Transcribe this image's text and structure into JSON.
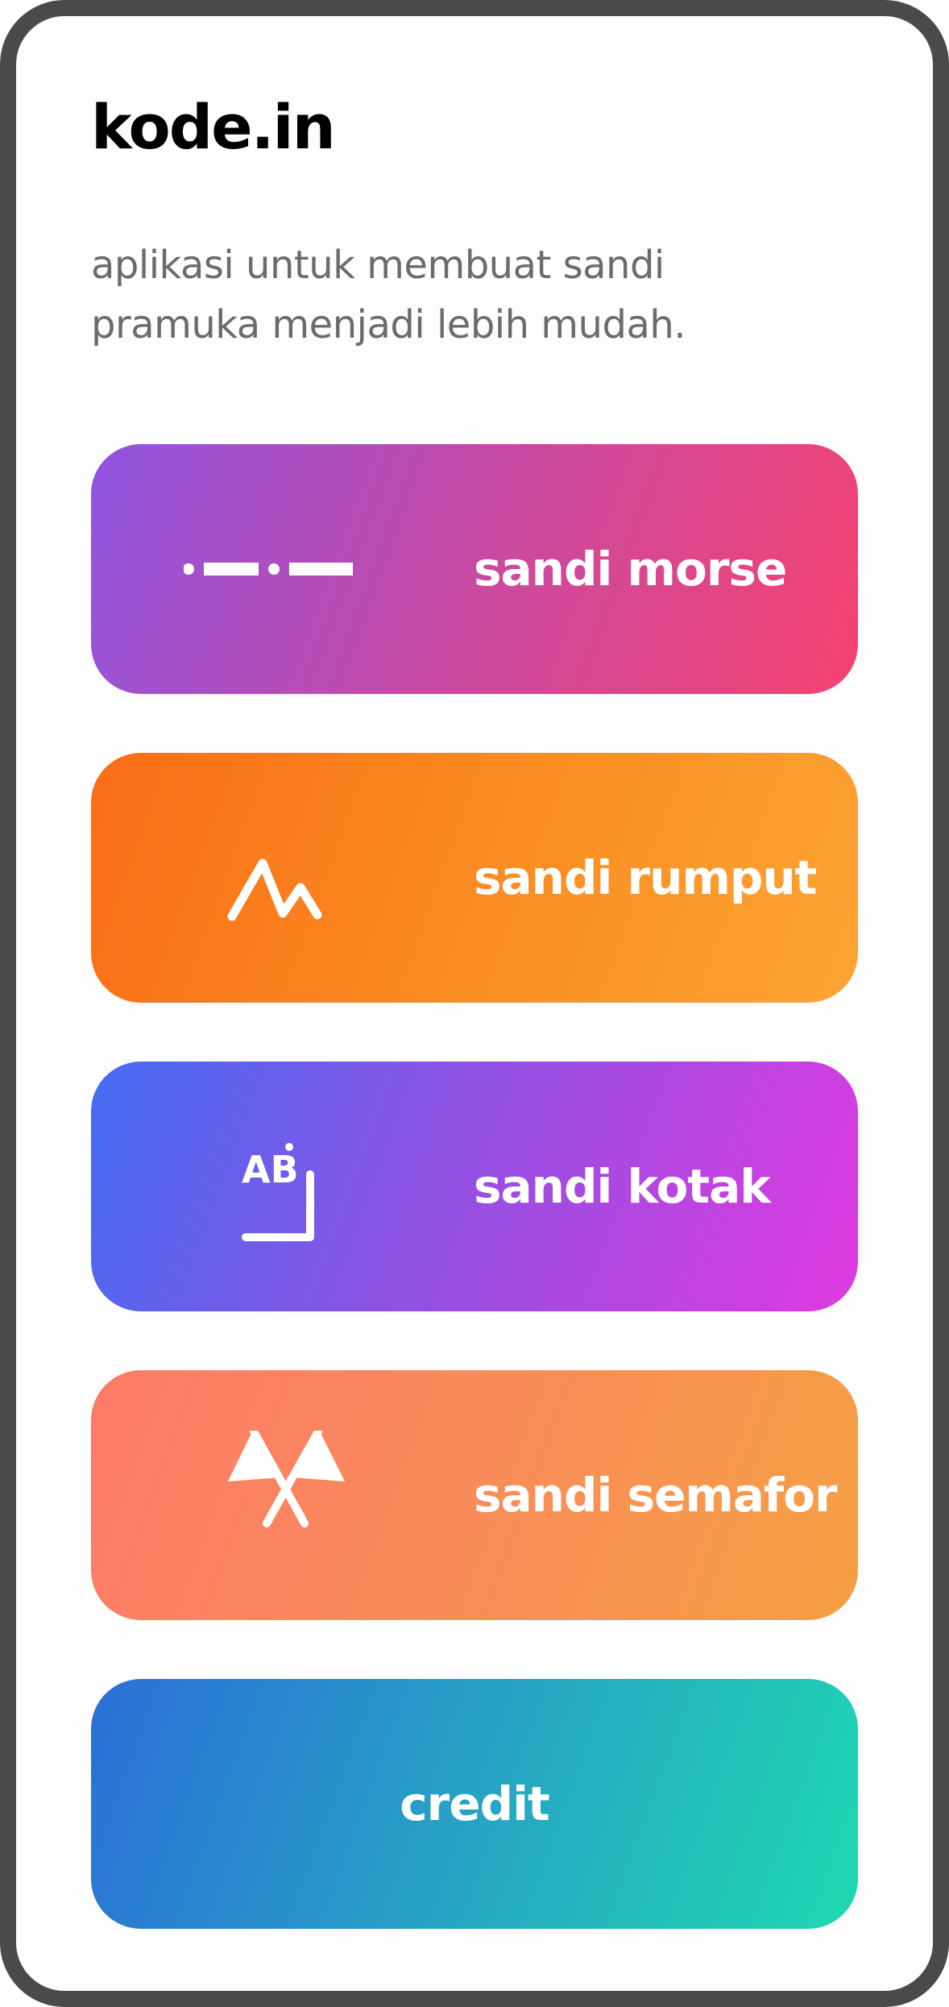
{
  "app": {
    "title": "kode.in",
    "subtitle": "aplikasi untuk membuat sandi\npramuka menjadi lebih mudah."
  },
  "menu": [
    {
      "id": "morse",
      "label": "sandi morse",
      "icon": "morse-code-icon"
    },
    {
      "id": "rumput",
      "label": "sandi rumput",
      "icon": "zigzag-grass-icon"
    },
    {
      "id": "kotak",
      "label": "sandi kotak",
      "icon": "box-cipher-icon",
      "icon_text": "AB"
    },
    {
      "id": "semafor",
      "label": "sandi semafor",
      "icon": "semaphore-flags-icon"
    },
    {
      "id": "credit",
      "label": "credit"
    }
  ],
  "colors": {
    "frame": "#4a4a4a",
    "title": "#000000",
    "subtitle": "#6b6b6b",
    "card_text": "#ffffff"
  }
}
